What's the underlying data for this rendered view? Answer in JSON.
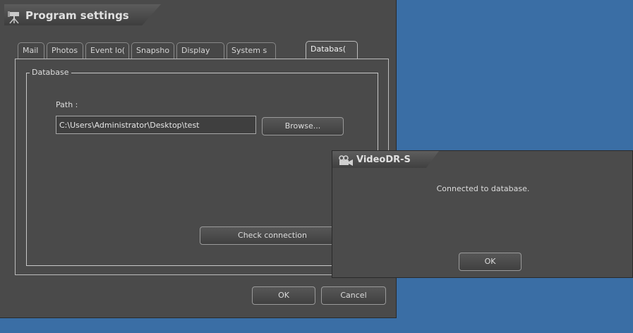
{
  "main_window": {
    "title": "Program settings",
    "tabs": [
      {
        "label": "Mail"
      },
      {
        "label": "Photos"
      },
      {
        "label": "Event lo("
      },
      {
        "label": "Snapsho"
      },
      {
        "label": "Display"
      },
      {
        "label": "System s"
      },
      {
        "label": "Databas("
      }
    ],
    "active_tab": "Databas(",
    "group_label": "Database",
    "path_label": "Path :",
    "path_value": "C:\\Users\\Administrator\\Desktop\\test",
    "browse_label": "Browse...",
    "check_label": "Check connection",
    "ok_label": "OK",
    "cancel_label": "Cancel"
  },
  "dialog": {
    "title": "VideoDR-S",
    "message": "Connected to database.",
    "ok_label": "OK"
  },
  "icons": {
    "main_title_icon": "camera-tripod-icon",
    "dialog_title_icon": "video-camera-icon"
  },
  "colors": {
    "desktop": "#3a6ea5",
    "window_bg": "#4a4a4a"
  }
}
